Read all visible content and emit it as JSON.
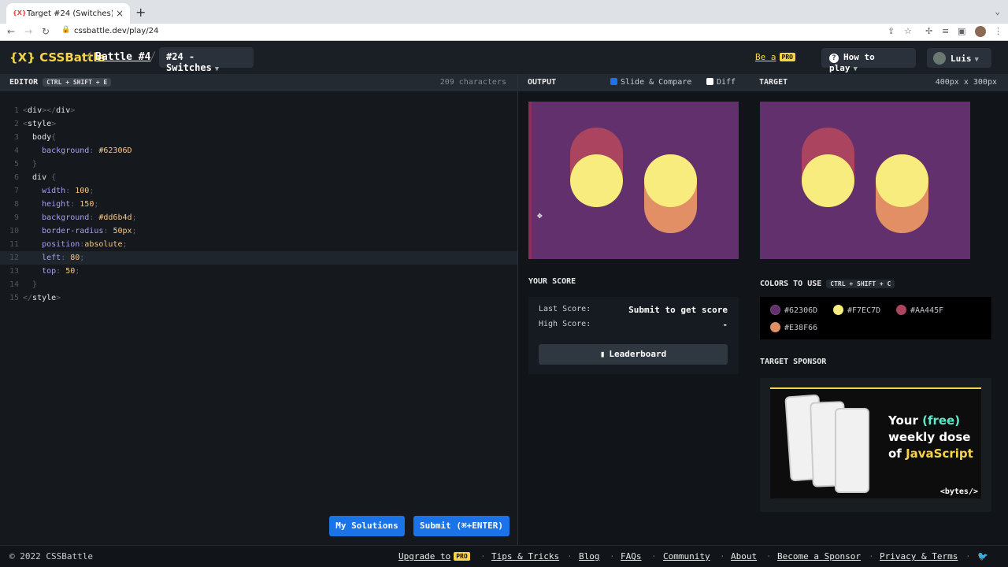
{
  "browser": {
    "tab_title": "Target #24 (Switches) - CSSB",
    "tab_close": "×",
    "new_tab": "+",
    "url": "cssbattle.dev/play/24"
  },
  "header": {
    "logo": "{X} CSSBattle",
    "sep": "/",
    "battle_link": "Battle #4",
    "target_select": "#24 - Switches",
    "be_a": "Be a",
    "pro": "PRO",
    "how_to_play": "How to play",
    "user": "Luis"
  },
  "editor": {
    "title": "EDITOR",
    "shortcut": "CTRL + SHIFT + E",
    "char_count": "209 characters",
    "line_numbers": [
      "1",
      "2",
      "3",
      "4",
      "5",
      "6",
      "7",
      "8",
      "9",
      "10",
      "11",
      "12",
      "13",
      "14",
      "15"
    ],
    "my_solutions": "My Solutions",
    "submit": "Submit (⌘+ENTER)"
  },
  "output": {
    "title": "OUTPUT",
    "slide_compare": "Slide & Compare",
    "diff": "Diff"
  },
  "target": {
    "title": "TARGET",
    "size": "400px x 300px"
  },
  "score": {
    "title": "YOUR SCORE",
    "last_label": "Last Score:",
    "last_value": "Submit to get score",
    "high_label": "High Score:",
    "high_value": "-",
    "leaderboard": "Leaderboard"
  },
  "colors": {
    "title": "COLORS TO USE",
    "shortcut": "CTRL + SHIFT + C",
    "items": [
      {
        "hex": "#62306D",
        "color": "#62306D"
      },
      {
        "hex": "#F7EC7D",
        "color": "#F7EC7D"
      },
      {
        "hex": "#AA445F",
        "color": "#AA445F"
      },
      {
        "hex": "#E38F66",
        "color": "#E38F66"
      }
    ]
  },
  "sponsor": {
    "title": "TARGET SPONSOR",
    "line1a": "Your ",
    "line1b": "(free)",
    "line2": "weekly dose",
    "line3a": "of ",
    "line3b": "JavaScript",
    "foot": "<bytes/>"
  },
  "footer": {
    "copyright": "© 2022 CSSBattle",
    "upgrade": "Upgrade to",
    "tips": "Tips & Tricks",
    "blog": "Blog",
    "faqs": "FAQs",
    "community": "Community",
    "about": "About",
    "sponsor": "Become a Sponsor",
    "privacy": "Privacy & Terms"
  }
}
